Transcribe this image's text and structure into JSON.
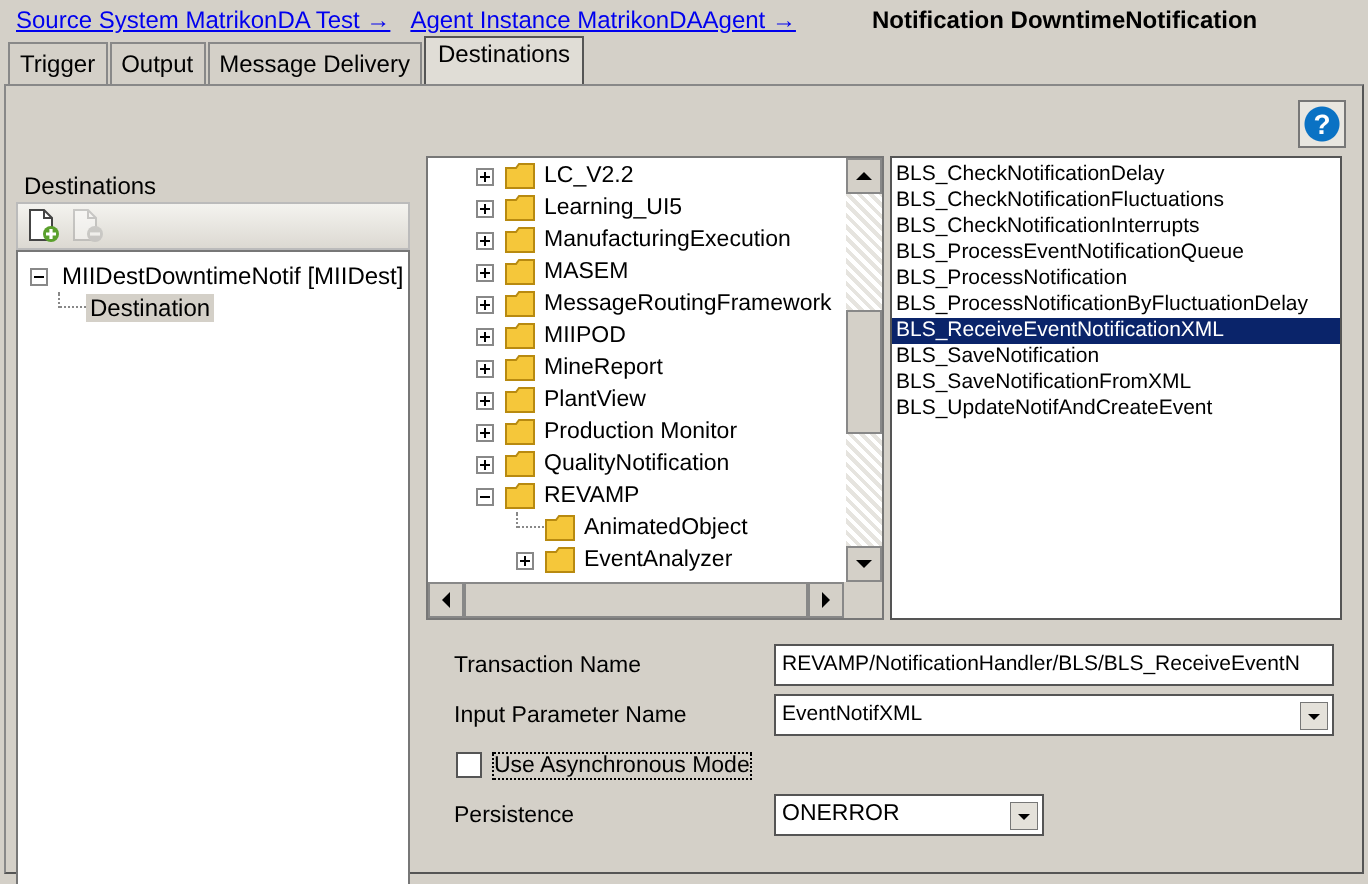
{
  "breadcrumb": {
    "links": [
      "Source System MatrikonDA Test →",
      "Agent Instance MatrikonDAAgent →"
    ],
    "current": "Notification DowntimeNotification"
  },
  "tabs": [
    {
      "label": "Trigger",
      "selected": false
    },
    {
      "label": "Output",
      "selected": false
    },
    {
      "label": "Message Delivery",
      "selected": false
    },
    {
      "label": "Destinations",
      "selected": true
    }
  ],
  "help_button": {
    "label": "?"
  },
  "destinations": {
    "title": "Destinations",
    "toolbar": [
      {
        "kind": "add",
        "disabled": false
      },
      {
        "kind": "remove",
        "disabled": true
      }
    ],
    "tree": [
      {
        "label": "MIIDestDowntimeNotif [MIIDest]",
        "expanded": true,
        "selected": false,
        "children": [
          {
            "label": "Destination",
            "selected": true
          }
        ]
      }
    ]
  },
  "folder_tree": [
    {
      "label": "LC_V2.2",
      "expanded": false
    },
    {
      "label": "Learning_UI5",
      "expanded": false
    },
    {
      "label": "ManufacturingExecution",
      "expanded": false
    },
    {
      "label": "MASEM",
      "expanded": false
    },
    {
      "label": "MessageRoutingFramework",
      "expanded": false
    },
    {
      "label": "MIIPOD",
      "expanded": false
    },
    {
      "label": "MineReport",
      "expanded": false
    },
    {
      "label": "PlantView",
      "expanded": false
    },
    {
      "label": "Production Monitor",
      "expanded": false
    },
    {
      "label": "QualityNotification",
      "expanded": false
    },
    {
      "label": "REVAMP",
      "expanded": true,
      "children": [
        {
          "label": "AnimatedObject"
        },
        {
          "label": "EventAnalyzer",
          "expanded": false
        }
      ]
    }
  ],
  "transactions": [
    {
      "label": "BLS_CheckNotificationDelay",
      "selected": false
    },
    {
      "label": "BLS_CheckNotificationFluctuations",
      "selected": false
    },
    {
      "label": "BLS_CheckNotificationInterrupts",
      "selected": false
    },
    {
      "label": "BLS_ProcessEventNotificationQueue",
      "selected": false
    },
    {
      "label": "BLS_ProcessNotification",
      "selected": false
    },
    {
      "label": "BLS_ProcessNotificationByFluctuationDelay",
      "selected": false
    },
    {
      "label": "BLS_ReceiveEventNotificationXML",
      "selected": true
    },
    {
      "label": "BLS_SaveNotification",
      "selected": false
    },
    {
      "label": "BLS_SaveNotificationFromXML",
      "selected": false
    },
    {
      "label": "BLS_UpdateNotifAndCreateEvent",
      "selected": false
    }
  ],
  "form": [
    {
      "kind": "text",
      "label": "Transaction Name",
      "value": "REVAMP/NotificationHandler/BLS/BLS_ReceiveEventN"
    },
    {
      "kind": "select",
      "label": "Input Parameter Name",
      "value": "EventNotifXML"
    },
    {
      "kind": "checkbox",
      "label": "Use Asynchronous Mode",
      "checked": false
    },
    {
      "kind": "select-short",
      "label": "Persistence",
      "value": "ONERROR"
    }
  ]
}
